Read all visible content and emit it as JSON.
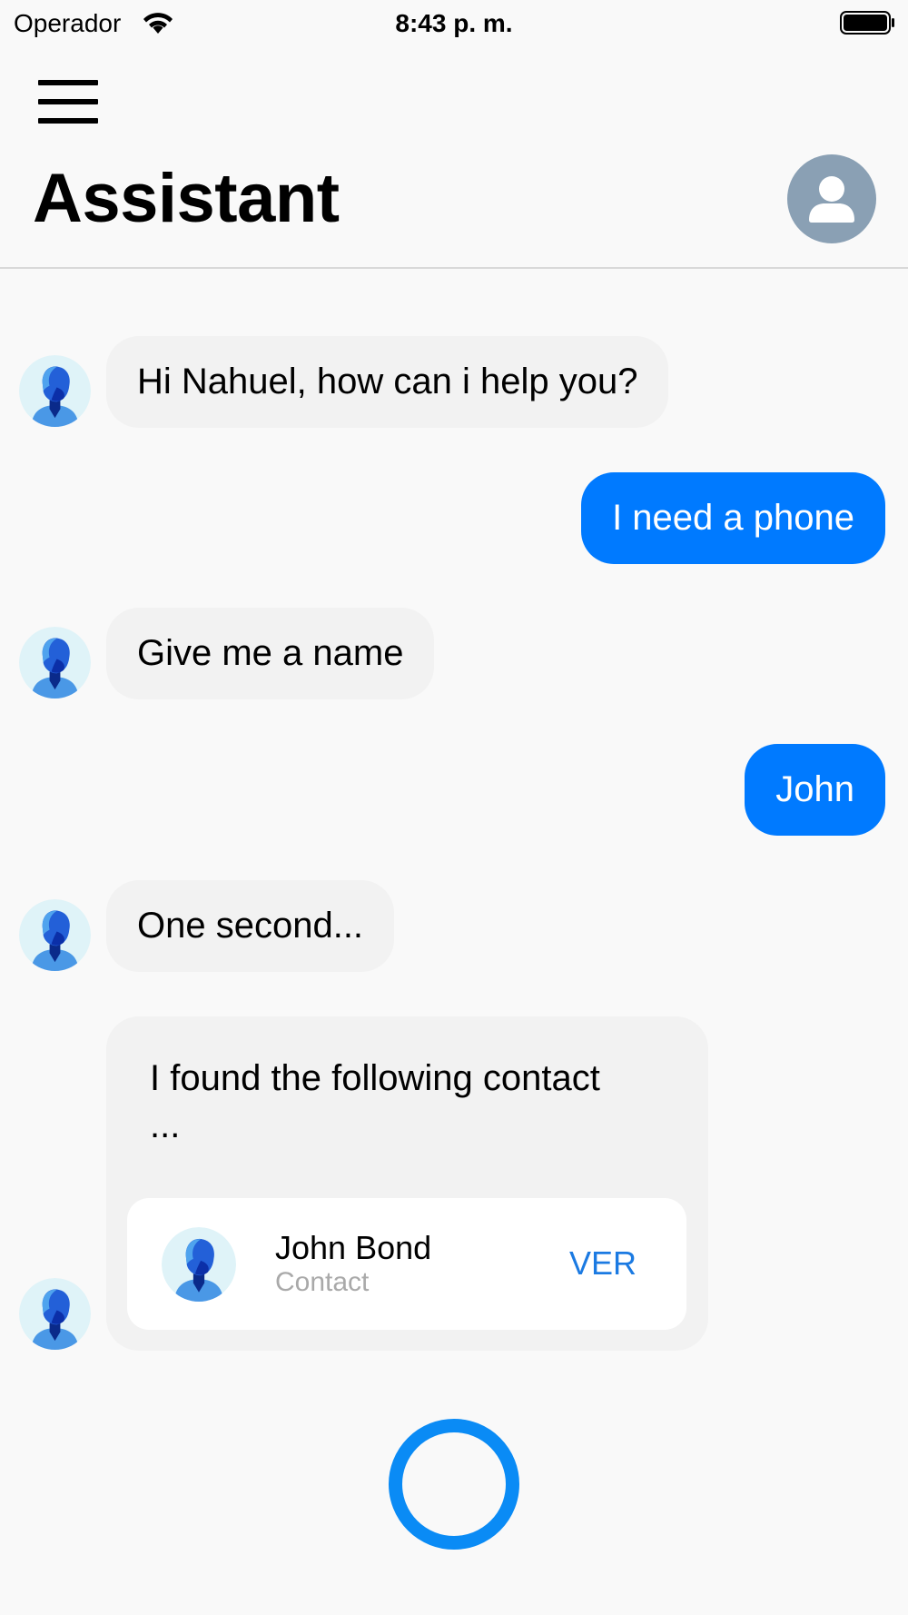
{
  "status_bar": {
    "carrier": "Operador",
    "time": "8:43 p. m.",
    "wifi_icon": "wifi-icon",
    "battery_icon": "battery-icon"
  },
  "header": {
    "menu_icon": "hamburger-menu-icon",
    "title": "Assistant",
    "profile_icon": "user-profile-icon"
  },
  "chat": {
    "messages": [
      {
        "sender": "bot",
        "text": "Hi Nahuel, how can i help you?"
      },
      {
        "sender": "user",
        "text": "I need a phone"
      },
      {
        "sender": "bot",
        "text": "Give me a name"
      },
      {
        "sender": "user",
        "text": "John"
      },
      {
        "sender": "bot",
        "text": "One second..."
      }
    ],
    "card": {
      "text": "I found the following contact ...",
      "contact": {
        "name": "John Bond",
        "type": "Contact",
        "action": "VER"
      }
    }
  },
  "mic": {
    "icon": "microphone-listen-icon"
  },
  "colors": {
    "background": "#f9f9f9",
    "bot_bubble": "#f2f2f2",
    "user_bubble": "#007aff",
    "accent": "#0a8bf5",
    "link": "#1b7ae2",
    "profile_circle": "#8aa0b4"
  }
}
